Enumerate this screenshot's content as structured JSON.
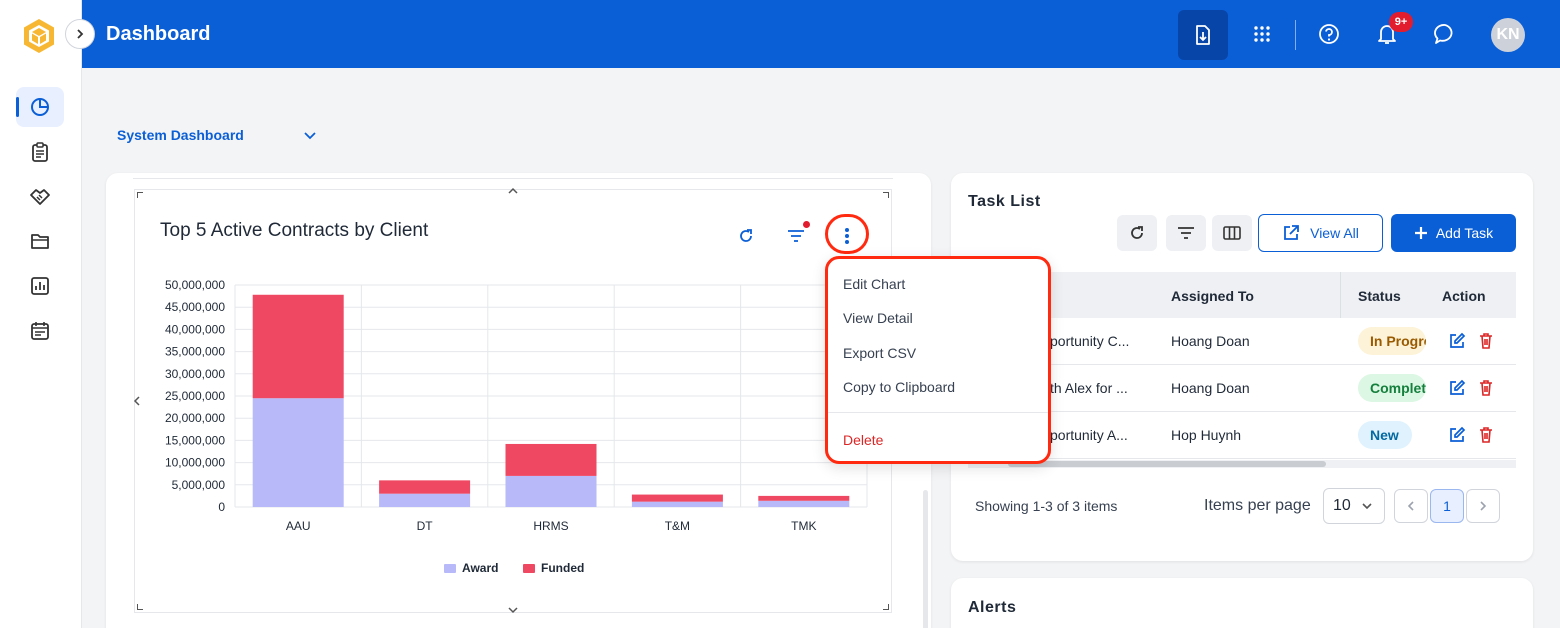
{
  "header": {
    "title": "Dashboard",
    "notification_count": "9+",
    "avatar_initials": "KN",
    "icons": [
      "download-icon",
      "apps-grid-icon",
      "help-icon",
      "bell-icon",
      "chat-icon"
    ]
  },
  "sidebar": {
    "items": [
      {
        "name": "dashboard",
        "icon": "pie-chart-icon",
        "active": true
      },
      {
        "name": "tasks",
        "icon": "clipboard-icon"
      },
      {
        "name": "deals",
        "icon": "handshake-icon"
      },
      {
        "name": "files",
        "icon": "folder-icon"
      },
      {
        "name": "reports",
        "icon": "bar-report-icon"
      },
      {
        "name": "calendar",
        "icon": "calendar-icon"
      }
    ]
  },
  "dashboard_selector": {
    "value": "System Dashboard"
  },
  "chart_card": {
    "title": "Top 5 Active Contracts by Client"
  },
  "chart_data": {
    "type": "bar",
    "stacked": true,
    "categories": [
      "AAU",
      "DT",
      "HRMS",
      "T&M",
      "TMK"
    ],
    "series": [
      {
        "name": "Award",
        "color": "#b7b9f9",
        "values": [
          24500000,
          3000000,
          7000000,
          1200000,
          1400000
        ]
      },
      {
        "name": "Funded",
        "color": "#ef4863",
        "values": [
          23300000,
          3000000,
          7200000,
          1600000,
          1100000
        ]
      }
    ],
    "ylim": [
      0,
      50000000
    ],
    "yticks": [
      "0",
      "5,000,000",
      "10,000,000",
      "15,000,000",
      "20,000,000",
      "25,000,000",
      "30,000,000",
      "35,000,000",
      "40,000,000",
      "45,000,000",
      "50,000,000"
    ],
    "grid": true,
    "legend": "bottom"
  },
  "chart_menu": {
    "items": [
      "Edit Chart",
      "View Detail",
      "Export CSV",
      "Copy to Clipboard"
    ],
    "danger_item": "Delete"
  },
  "task_list": {
    "title": "Task List",
    "view_all_label": "View All",
    "add_task_label": "Add Task",
    "columns": [
      "Assigned To",
      "Status",
      "Action"
    ],
    "rows": [
      {
        "task": "portunity C...",
        "assigned": "Hoang Doan",
        "status": "In Progress",
        "status_color": "#fdf3d8",
        "status_text_color": "#9a5b00"
      },
      {
        "task": "th Alex for ...",
        "assigned": "Hoang Doan",
        "status": "Complete",
        "status_color": "#dcf7e3",
        "status_text_color": "#15803d"
      },
      {
        "task": "portunity A...",
        "assigned": "Hop Huynh",
        "status": "New",
        "status_color": "#e0f2fe",
        "status_text_color": "#0369a1"
      }
    ],
    "showing": "Showing 1-3 of 3 items",
    "items_per_page_label": "Items per page",
    "items_per_page": "10",
    "current_page": "1"
  },
  "alerts": {
    "title": "Alerts"
  }
}
